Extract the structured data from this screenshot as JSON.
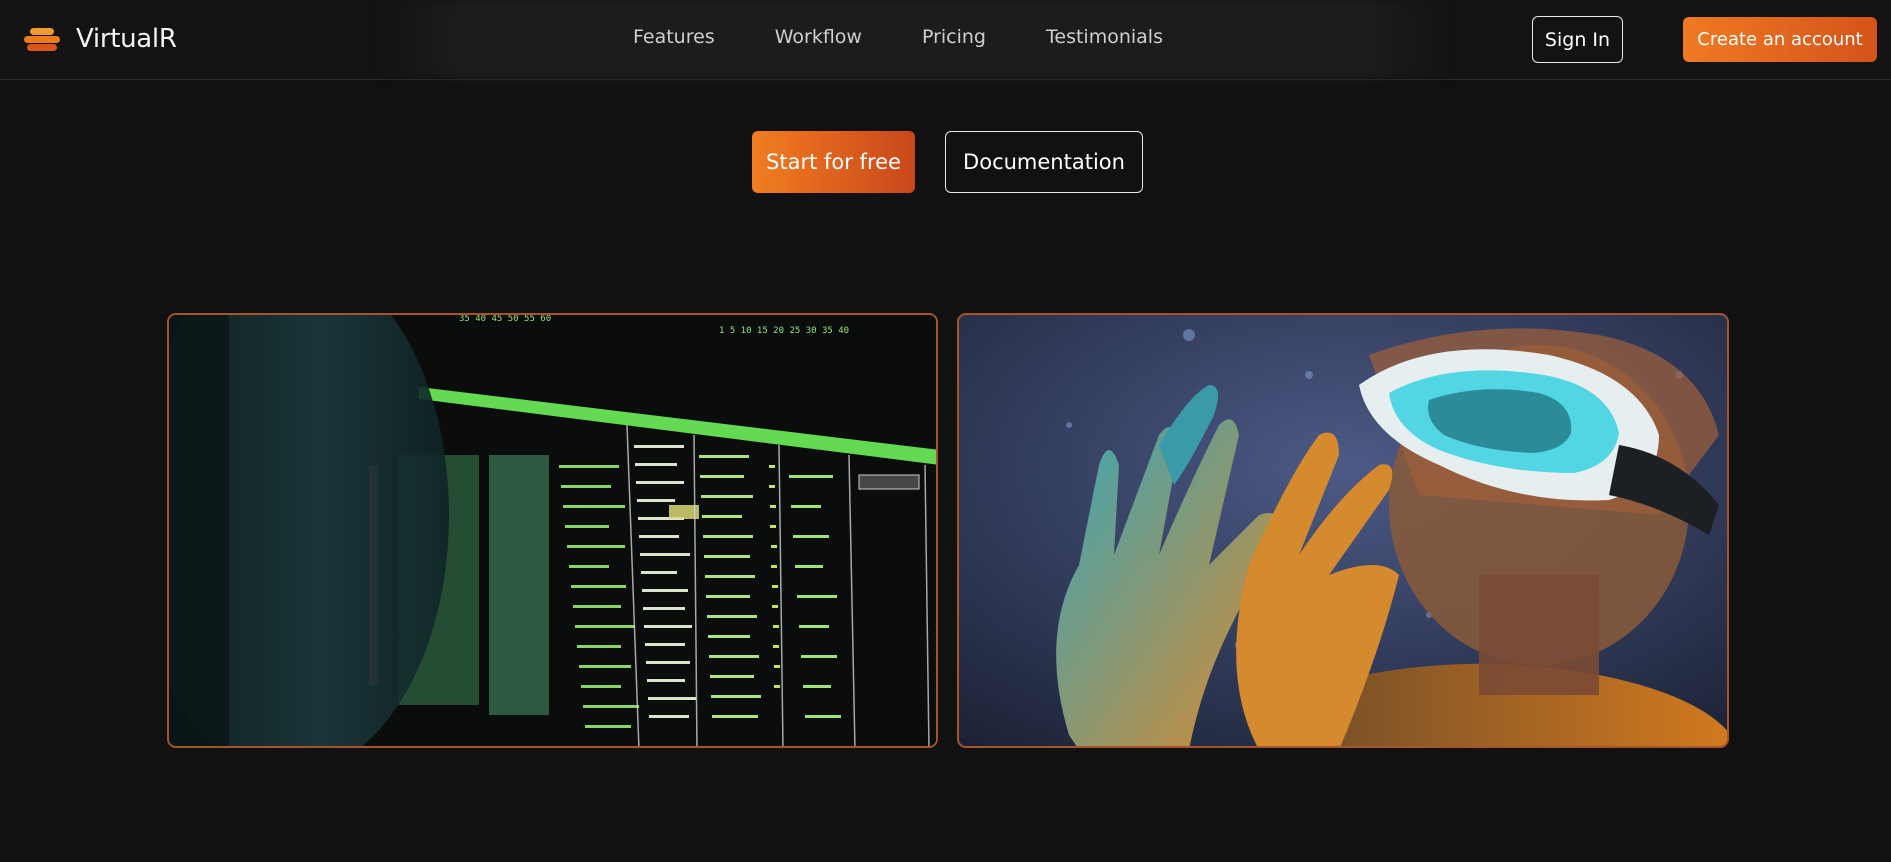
{
  "brand": {
    "name": "VirtualR",
    "logo_icon": "layered-disc-icon"
  },
  "nav": {
    "links": [
      "Features",
      "Workflow",
      "Pricing",
      "Testimonials"
    ],
    "signin_label": "Sign In",
    "create_label": "Create an account"
  },
  "hero": {
    "primary_label": "Start for free",
    "secondary_label": "Documentation"
  },
  "gallery": [
    {
      "name": "terminal-code-image",
      "alt": "terminal screen with code"
    },
    {
      "name": "vr-headset-image",
      "alt": "person wearing VR headset"
    }
  ],
  "colors": {
    "accent": "#f07a22",
    "accent_dark": "#c8471a",
    "background": "#111111",
    "card_border": "#a8542a"
  }
}
